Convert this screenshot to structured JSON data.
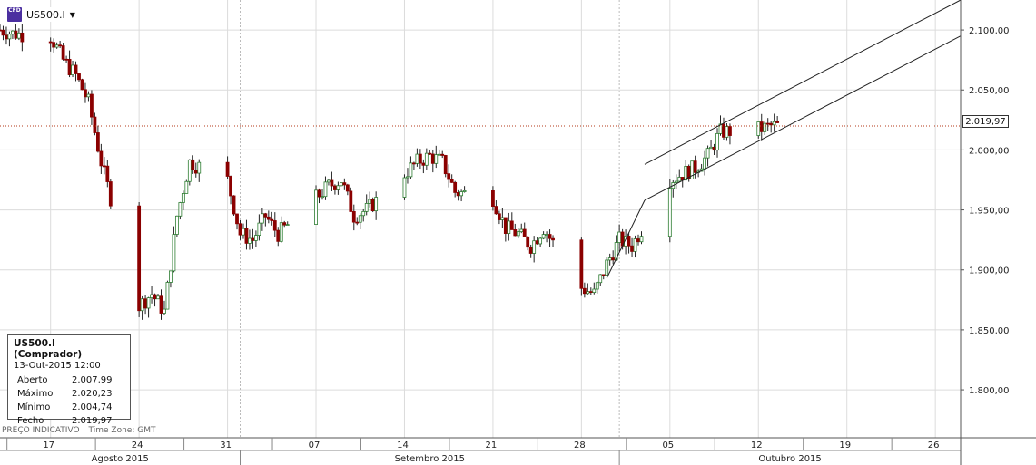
{
  "symbol": {
    "name": "US500.I",
    "icon": "cfd-icon",
    "icon_text": "CFD"
  },
  "info_panel": {
    "title": "US500.I (Comprador)",
    "date": "13-Out-2015 12:00",
    "rows": [
      {
        "label": "Aberto",
        "value": "2.007,99"
      },
      {
        "label": "Máximo",
        "value": "2.020,23"
      },
      {
        "label": "Mínimo",
        "value": "2.004,74"
      },
      {
        "label": "Fecho",
        "value": "2.019,97"
      }
    ]
  },
  "footer": {
    "indicative": "PREÇO INDICATIVO",
    "timezone": "Time Zone: GMT"
  },
  "current_price_label": "2.019,97",
  "colors": {
    "up": "#2e7d32",
    "down": "#8b0000",
    "grid": "#dcdcdc",
    "price_line": "#b33a1a",
    "channel": "#222222"
  },
  "chart_data": {
    "type": "candlestick",
    "series_name": "US500.I",
    "ylim": [
      1760,
      2125
    ],
    "y_ticks": [
      {
        "value": 2100,
        "label": "2.100,00"
      },
      {
        "value": 2050,
        "label": "2.050,00"
      },
      {
        "value": 2000,
        "label": "2.000,00"
      },
      {
        "value": 1950,
        "label": "1.950,00"
      },
      {
        "value": 1900,
        "label": "1.900,00"
      },
      {
        "value": 1850,
        "label": "1.850,00"
      },
      {
        "value": 1800,
        "label": "1.800,00"
      }
    ],
    "x_start": "2015-08-13",
    "x_end": "2015-10-28",
    "x_ticks": [
      {
        "date": "2015-08-17",
        "label": "17"
      },
      {
        "date": "2015-08-24",
        "label": "24"
      },
      {
        "date": "2015-08-31",
        "label": "31"
      },
      {
        "date": "2015-09-07",
        "label": "07"
      },
      {
        "date": "2015-09-14",
        "label": "14"
      },
      {
        "date": "2015-09-21",
        "label": "21"
      },
      {
        "date": "2015-09-28",
        "label": "28"
      },
      {
        "date": "2015-10-05",
        "label": "05"
      },
      {
        "date": "2015-10-12",
        "label": "12"
      },
      {
        "date": "2015-10-19",
        "label": "19"
      },
      {
        "date": "2015-10-26",
        "label": "26"
      }
    ],
    "months": [
      {
        "label": "Agosto 2015",
        "start": "2015-08-13",
        "end": "2015-09-01"
      },
      {
        "label": "Setembro 2015",
        "start": "2015-09-01",
        "end": "2015-10-01"
      },
      {
        "label": "Outubro 2015",
        "start": "2015-10-01",
        "end": "2015-10-28"
      }
    ],
    "current_price": 2019.97,
    "price_path": [
      [
        "2015-08-13",
        2100
      ],
      [
        "2015-08-14",
        2097
      ],
      [
        "2015-08-17",
        2095
      ],
      [
        "2015-08-18",
        2075
      ],
      [
        "2015-08-19",
        2062
      ],
      [
        "2015-08-20",
        2040
      ],
      [
        "2015-08-21",
        1990
      ],
      [
        "2015-08-24",
        1870
      ],
      [
        "2015-08-25",
        1880
      ],
      [
        "2015-08-26",
        1865
      ],
      [
        "2015-08-27",
        1945
      ],
      [
        "2015-08-28",
        1990
      ],
      [
        "2015-08-31",
        1975
      ],
      [
        "2015-09-01",
        1930
      ],
      [
        "2015-09-02",
        1925
      ],
      [
        "2015-09-03",
        1945
      ],
      [
        "2015-09-04",
        1930
      ],
      [
        "2015-09-08",
        1970
      ],
      [
        "2015-09-09",
        1975
      ],
      [
        "2015-09-10",
        1945
      ],
      [
        "2015-09-11",
        1950
      ],
      [
        "2015-09-14",
        1980
      ],
      [
        "2015-09-15",
        1990
      ],
      [
        "2015-09-16",
        1995
      ],
      [
        "2015-09-17",
        1990
      ],
      [
        "2015-09-18",
        1965
      ],
      [
        "2015-09-21",
        1960
      ],
      [
        "2015-09-22",
        1935
      ],
      [
        "2015-09-23",
        1930
      ],
      [
        "2015-09-24",
        1920
      ],
      [
        "2015-09-25",
        1935
      ],
      [
        "2015-09-28",
        1885
      ],
      [
        "2015-09-29",
        1880
      ],
      [
        "2015-09-30",
        1905
      ],
      [
        "2015-10-01",
        1925
      ],
      [
        "2015-10-02",
        1920
      ],
      [
        "2015-10-05",
        1975
      ],
      [
        "2015-10-06",
        1980
      ],
      [
        "2015-10-07",
        1985
      ],
      [
        "2015-10-08",
        1995
      ],
      [
        "2015-10-09",
        2015
      ],
      [
        "2015-10-12",
        2017
      ],
      [
        "2015-10-13",
        2020
      ]
    ],
    "channel_lines": [
      {
        "from": [
          "2015-10-03",
          1988
        ],
        "to": [
          "2015-10-28",
          2125
        ]
      },
      {
        "from": [
          "2015-10-03",
          1958
        ],
        "to": [
          "2015-10-28",
          2095
        ]
      }
    ],
    "trend_line": {
      "from": [
        "2015-09-30",
        1893
      ],
      "to": [
        "2015-10-03",
        1958
      ]
    }
  }
}
